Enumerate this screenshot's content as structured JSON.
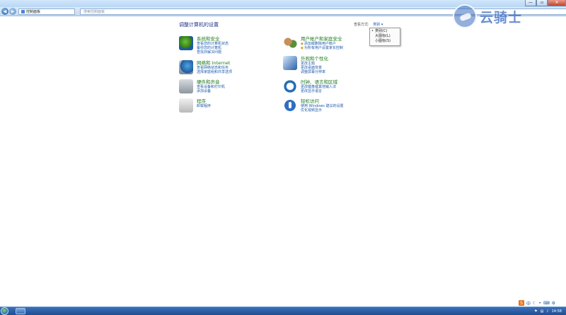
{
  "window": {
    "minimize": "—",
    "maximize": "▫",
    "close": "✕"
  },
  "address": {
    "back": "◀",
    "forward": "▶",
    "path": "控制面板",
    "search_placeholder": "搜索控制面板"
  },
  "heading": "调整计算机的设置",
  "view_by": {
    "label": "查看方式:",
    "value": "类别 ▾",
    "options": [
      "类别(C)",
      "大图标(L)",
      "小图标(S)"
    ],
    "selected_marker": "•"
  },
  "categories": [
    {
      "title": "系统和安全",
      "icon": "shield-icon",
      "links": [
        "查看您的计算机状态",
        "备份您的计算机",
        "查找并解决问题"
      ]
    },
    {
      "title": "网络和 Internet",
      "icon": "network-icon",
      "links": [
        "查看网络状态和任务",
        "选择家庭组和共享选项"
      ]
    },
    {
      "title": "硬件和声音",
      "icon": "printer-icon",
      "links": [
        "查看设备和打印机",
        "添加设备"
      ]
    },
    {
      "title": "程序",
      "icon": "programs-icon",
      "links": [
        "卸载程序"
      ]
    },
    {
      "title": "用户帐户和家庭安全",
      "icon": "users-icon",
      "links": [
        "添加或删除用户帐户",
        "为所有用户设置家长控制"
      ]
    },
    {
      "title": "外观和个性化",
      "icon": "appearance-icon",
      "links": [
        "更改主题",
        "更改桌面背景",
        "调整屏幕分辨率"
      ]
    },
    {
      "title": "时钟、语言和区域",
      "icon": "clock-icon",
      "links": [
        "更改键盘或其他输入法",
        "更改显示语言"
      ]
    },
    {
      "title": "轻松访问",
      "icon": "accessibility-icon",
      "links": [
        "使用 Windows 建议的设置",
        "优化视频显示"
      ]
    }
  ],
  "watermark": {
    "text": "云骑士"
  },
  "taskbar": {
    "ime_label": "中",
    "clock_time": "14:58"
  },
  "colors": {
    "link": "#1d5aab",
    "category_title": "#1f7a1f",
    "taskbar": "#2b5fa6"
  }
}
